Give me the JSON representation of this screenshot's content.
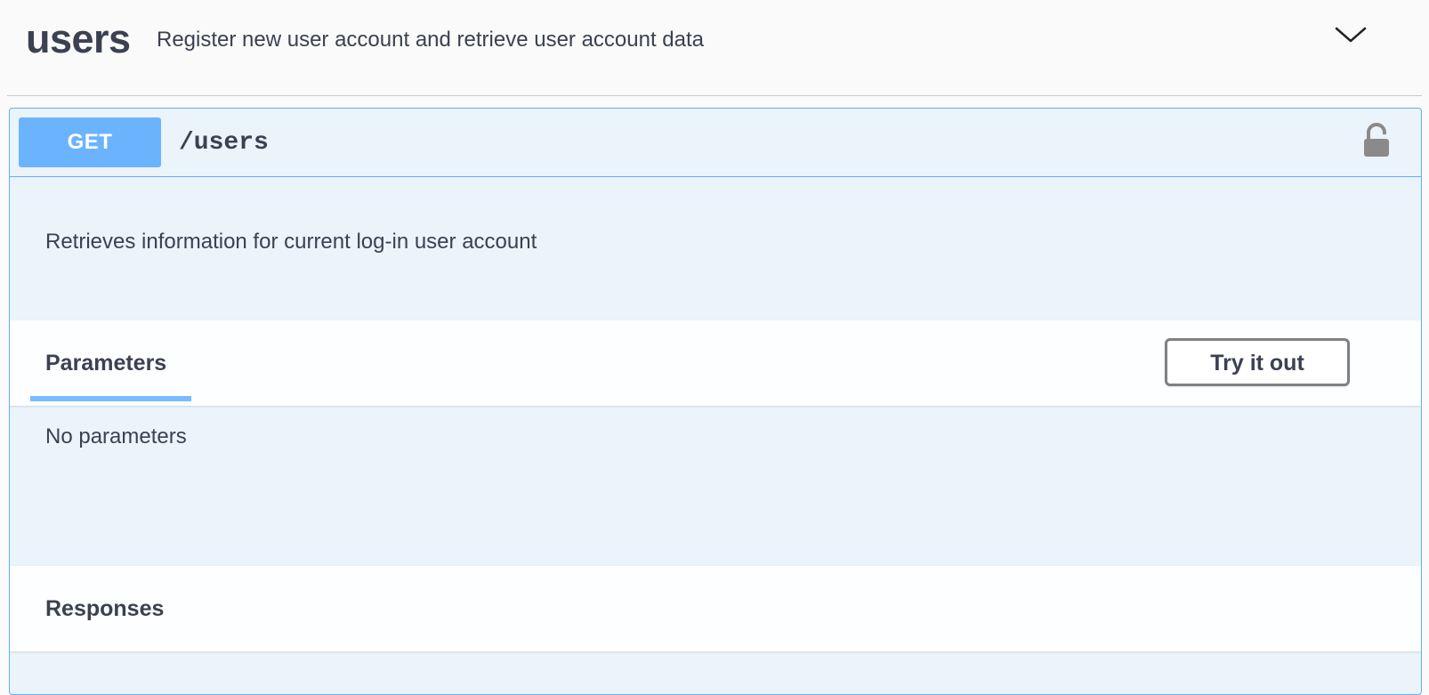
{
  "tag": {
    "name": "users",
    "description": "Register new user account and retrieve user account data"
  },
  "operation": {
    "method": "GET",
    "path": "/users",
    "description": "Retrieves information for current log-in user account",
    "parameters_title": "Parameters",
    "try_button_label": "Try it out",
    "no_parameters_text": "No parameters",
    "responses_title": "Responses"
  },
  "icons": {
    "expand": "chevron-down-icon",
    "auth": "lock-icon"
  },
  "colors": {
    "get_method": "#61affe",
    "opblock_background": "#ebf3fb",
    "text": "#3b4151"
  }
}
